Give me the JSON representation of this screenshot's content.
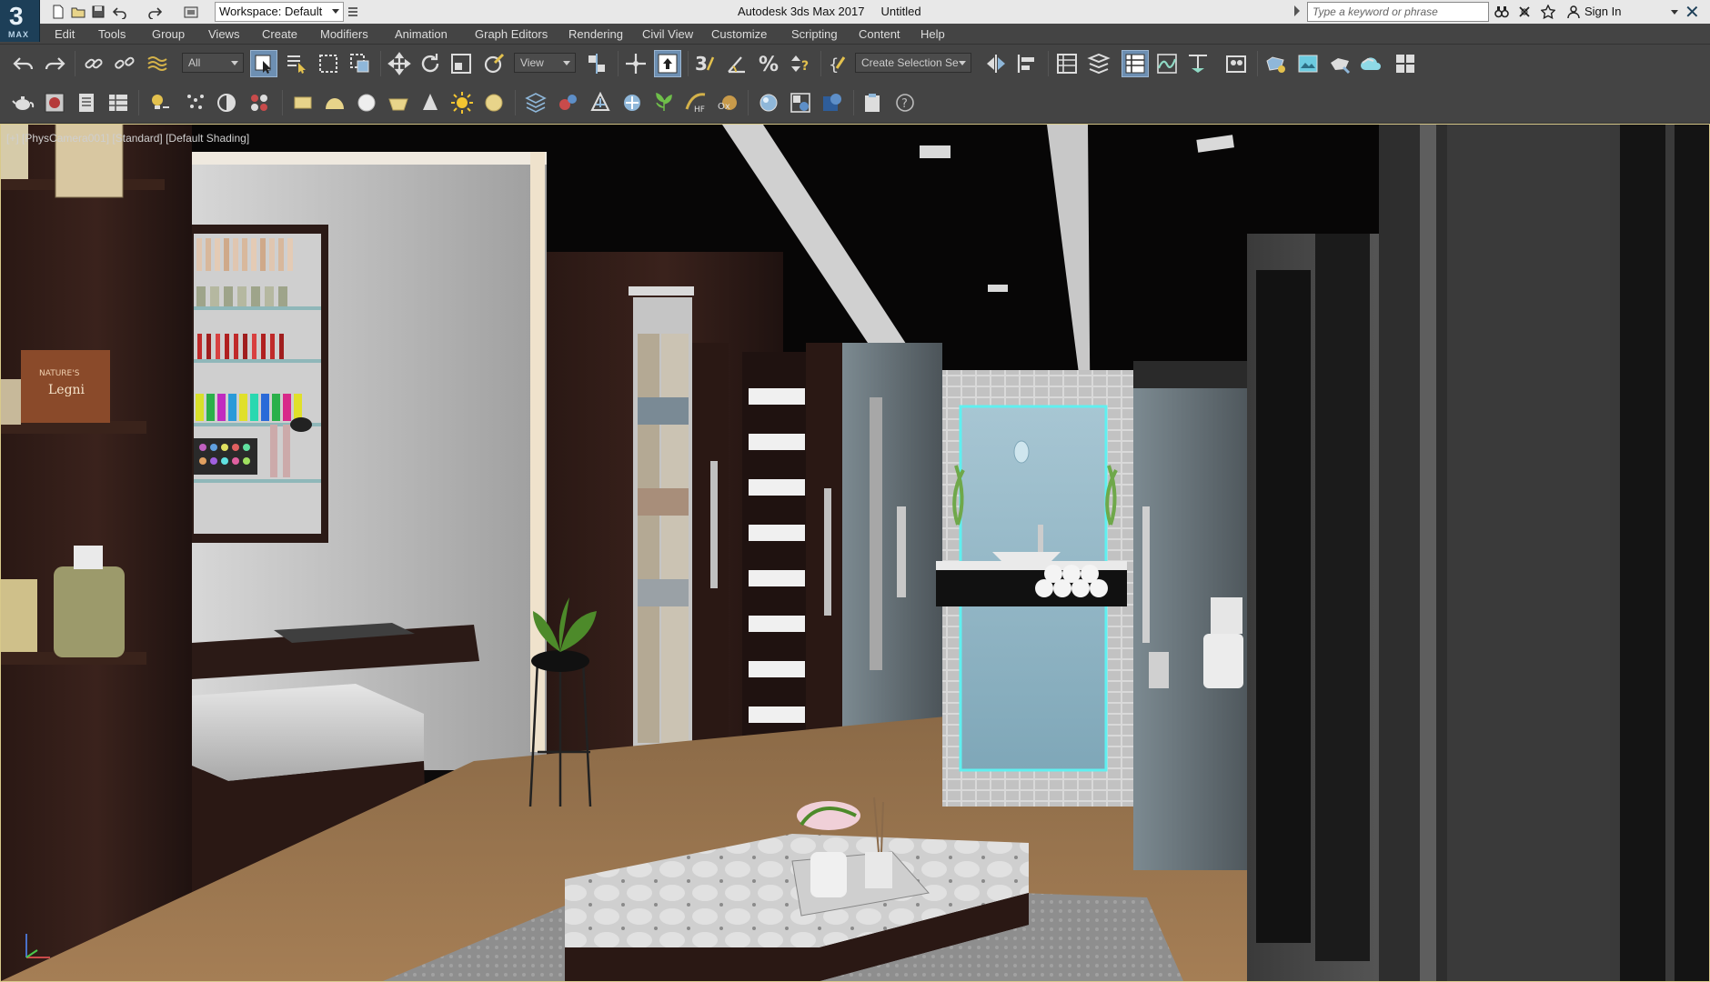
{
  "app": {
    "logo_number": "3",
    "logo_sub": "MAX",
    "title": "Autodesk 3ds Max 2017     Untitled"
  },
  "workspace": {
    "label": "Workspace: Default"
  },
  "search": {
    "placeholder": "Type a keyword or phrase"
  },
  "account": {
    "signin_label": "Sign In"
  },
  "menu": [
    "Edit",
    "Tools",
    "Group",
    "Views",
    "Create",
    "Modifiers",
    "Animation",
    "Graph Editors",
    "Rendering",
    "Civil View",
    "Customize",
    "Scripting",
    "Content",
    "Help"
  ],
  "toolbar": {
    "selection_filter": "All",
    "ref_coord": "View",
    "named_selection": "Create Selection Se"
  },
  "viewport": {
    "label": "[+] [PhysCamera001] [Standard] [Default Shading]"
  },
  "scene_text": {
    "product_brand": "NATURE'S",
    "product_name": "Legni"
  },
  "colors": {
    "accent": "#6d8fb2",
    "titlebar": "#e8e8e8",
    "ui_dark": "#444444",
    "logo_bg": "#1d3f58"
  }
}
